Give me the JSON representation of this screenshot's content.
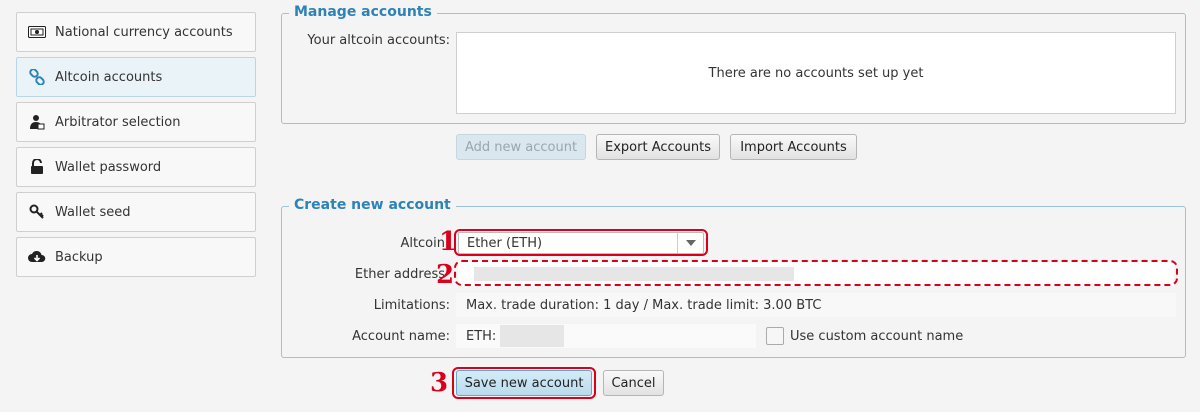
{
  "sidebar": {
    "items": [
      {
        "label": "National currency accounts",
        "icon": "banknote-icon",
        "active": false
      },
      {
        "label": "Altcoin accounts",
        "icon": "link-icon",
        "active": true
      },
      {
        "label": "Arbitrator selection",
        "icon": "arbitrator-icon",
        "active": false
      },
      {
        "label": "Wallet password",
        "icon": "unlock-icon",
        "active": false
      },
      {
        "label": "Wallet seed",
        "icon": "key-icon",
        "active": false
      },
      {
        "label": "Backup",
        "icon": "cloud-download-icon",
        "active": false
      }
    ]
  },
  "manage": {
    "title": "Manage accounts",
    "accounts_label": "Your altcoin accounts:",
    "empty_text": "There are no accounts set up yet",
    "add_button": "Add new account",
    "export_button": "Export Accounts",
    "import_button": "Import Accounts"
  },
  "create": {
    "title": "Create new account",
    "altcoin_label": "Altcoin",
    "altcoin_value": "Ether (ETH)",
    "address_label": "Ether address",
    "address_value": "",
    "limitations_label": "Limitations:",
    "limitations_value": "Max. trade duration: 1 day / Max. trade limit: 3.00 BTC",
    "account_name_label": "Account name:",
    "account_name_value": "ETH:",
    "custom_name_label": "Use custom account name",
    "custom_name_checked": false,
    "save_button": "Save new account",
    "cancel_button": "Cancel"
  },
  "annotations": {
    "marker1": "1",
    "marker2": "2",
    "marker3": "3",
    "color": "#d9001b"
  }
}
